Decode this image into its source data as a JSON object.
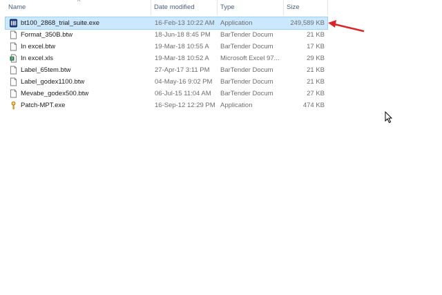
{
  "columns": {
    "name": "Name",
    "date_modified": "Date modified",
    "type": "Type",
    "size": "Size"
  },
  "files": [
    {
      "name": "bt100_2868_trial_suite.exe",
      "date": "16-Feb-13 10:22 AM",
      "type": "Application",
      "size": "249,589 KB",
      "icon": "bartender-installer-icon",
      "selected": true
    },
    {
      "name": "Format_350B.btw",
      "date": "18-Jun-18 8:45 PM",
      "type": "BarTender Docum",
      "size": "21 KB",
      "icon": "document-icon"
    },
    {
      "name": "In excel.btw",
      "date": "19-Mar-18 10:55 A",
      "type": "BarTender Docum",
      "size": "17 KB",
      "icon": "document-icon"
    },
    {
      "name": "In excel.xls",
      "date": "19-Mar-18 10:52 A",
      "type": "Microsoft Excel 97...",
      "size": "29 KB",
      "icon": "excel-icon"
    },
    {
      "name": "Label_65tem.btw",
      "date": "27-Apr-17 3:11 PM",
      "type": "BarTender Docum",
      "size": "21 KB",
      "icon": "document-icon"
    },
    {
      "name": "Label_godex1100.btw",
      "date": "04-May-16 9:02 PM",
      "type": "BarTender Docum",
      "size": "21 KB",
      "icon": "document-icon"
    },
    {
      "name": "Mevabe_godex500.btw",
      "date": "06-Jul-15 11:04 AM",
      "type": "BarTender Docum",
      "size": "27 KB",
      "icon": "document-icon"
    },
    {
      "name": "Patch-MPT.exe",
      "date": "16-Sep-12 12:29 PM",
      "type": "Application",
      "size": "474 KB",
      "icon": "key-icon"
    }
  ],
  "colors": {
    "selection_bg": "#cce8ff",
    "arrow": "#d9262a"
  }
}
